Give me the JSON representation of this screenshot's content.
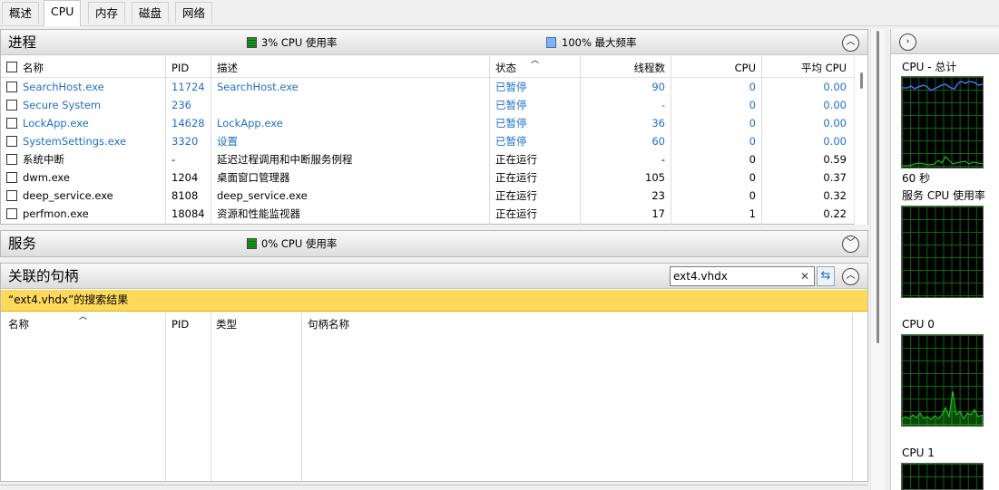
{
  "tabs": [
    "概述",
    "CPU",
    "内存",
    "磁盘",
    "网络"
  ],
  "processes": {
    "title": "进程",
    "cpu_usage": "3% CPU 使用率",
    "max_freq": "100% 最大频率",
    "columns": [
      "名称",
      "PID",
      "描述",
      "状态",
      "线程数",
      "CPU",
      "平均 CPU"
    ],
    "rows": [
      {
        "name": "SearchHost.exe",
        "pid": "11724",
        "desc": "SearchHost.exe",
        "status": "已暂停",
        "threads": "90",
        "cpu": "0",
        "avg": "0.00",
        "suspended": true
      },
      {
        "name": "Secure System",
        "pid": "236",
        "desc": "",
        "status": "已暂停",
        "threads": "-",
        "cpu": "0",
        "avg": "0.00",
        "suspended": true
      },
      {
        "name": "LockApp.exe",
        "pid": "14628",
        "desc": "LockApp.exe",
        "status": "已暂停",
        "threads": "36",
        "cpu": "0",
        "avg": "0.00",
        "suspended": true
      },
      {
        "name": "SystemSettings.exe",
        "pid": "3320",
        "desc": "设置",
        "status": "已暂停",
        "threads": "60",
        "cpu": "0",
        "avg": "0.00",
        "suspended": true
      },
      {
        "name": "系统中断",
        "pid": "-",
        "desc": "延迟过程调用和中断服务例程",
        "status": "正在运行",
        "threads": "-",
        "cpu": "0",
        "avg": "0.59",
        "suspended": false
      },
      {
        "name": "dwm.exe",
        "pid": "1204",
        "desc": "桌面窗口管理器",
        "status": "正在运行",
        "threads": "105",
        "cpu": "0",
        "avg": "0.37",
        "suspended": false
      },
      {
        "name": "deep_service.exe",
        "pid": "8108",
        "desc": "deep_service.exe",
        "status": "正在运行",
        "threads": "23",
        "cpu": "0",
        "avg": "0.32",
        "suspended": false
      },
      {
        "name": "perfmon.exe",
        "pid": "18084",
        "desc": "资源和性能监视器",
        "status": "正在运行",
        "threads": "17",
        "cpu": "1",
        "avg": "0.22",
        "suspended": false
      }
    ]
  },
  "services": {
    "title": "服务",
    "cpu_usage": "0% CPU 使用率"
  },
  "handles": {
    "title": "关联的句柄",
    "search_value": "ext4.vhdx",
    "result_text": "“ext4.vhdx”的搜索结果",
    "columns": [
      "名称",
      "PID",
      "类型",
      "句柄名称"
    ]
  },
  "right_panel": {
    "cpu_total": "CPU - 总计",
    "time_label": "60 秒",
    "service_cpu": "服务 CPU 使用率",
    "cpu0": "CPU 0",
    "cpu1": "CPU 1"
  },
  "colors": {
    "suspended_text": "#1f6fc9",
    "search_highlight": "#ffd95a",
    "graph_grid": "#0a6b0a",
    "graph_line": "#1fd11f",
    "graph_freq_line": "#3f6fff"
  },
  "icons": {
    "collapse": "chevron-up-icon",
    "expand": "chevron-down-icon",
    "sidebar_toggle": "chevron-right-icon",
    "clear": "close-icon",
    "search": "refresh-search-icon"
  }
}
